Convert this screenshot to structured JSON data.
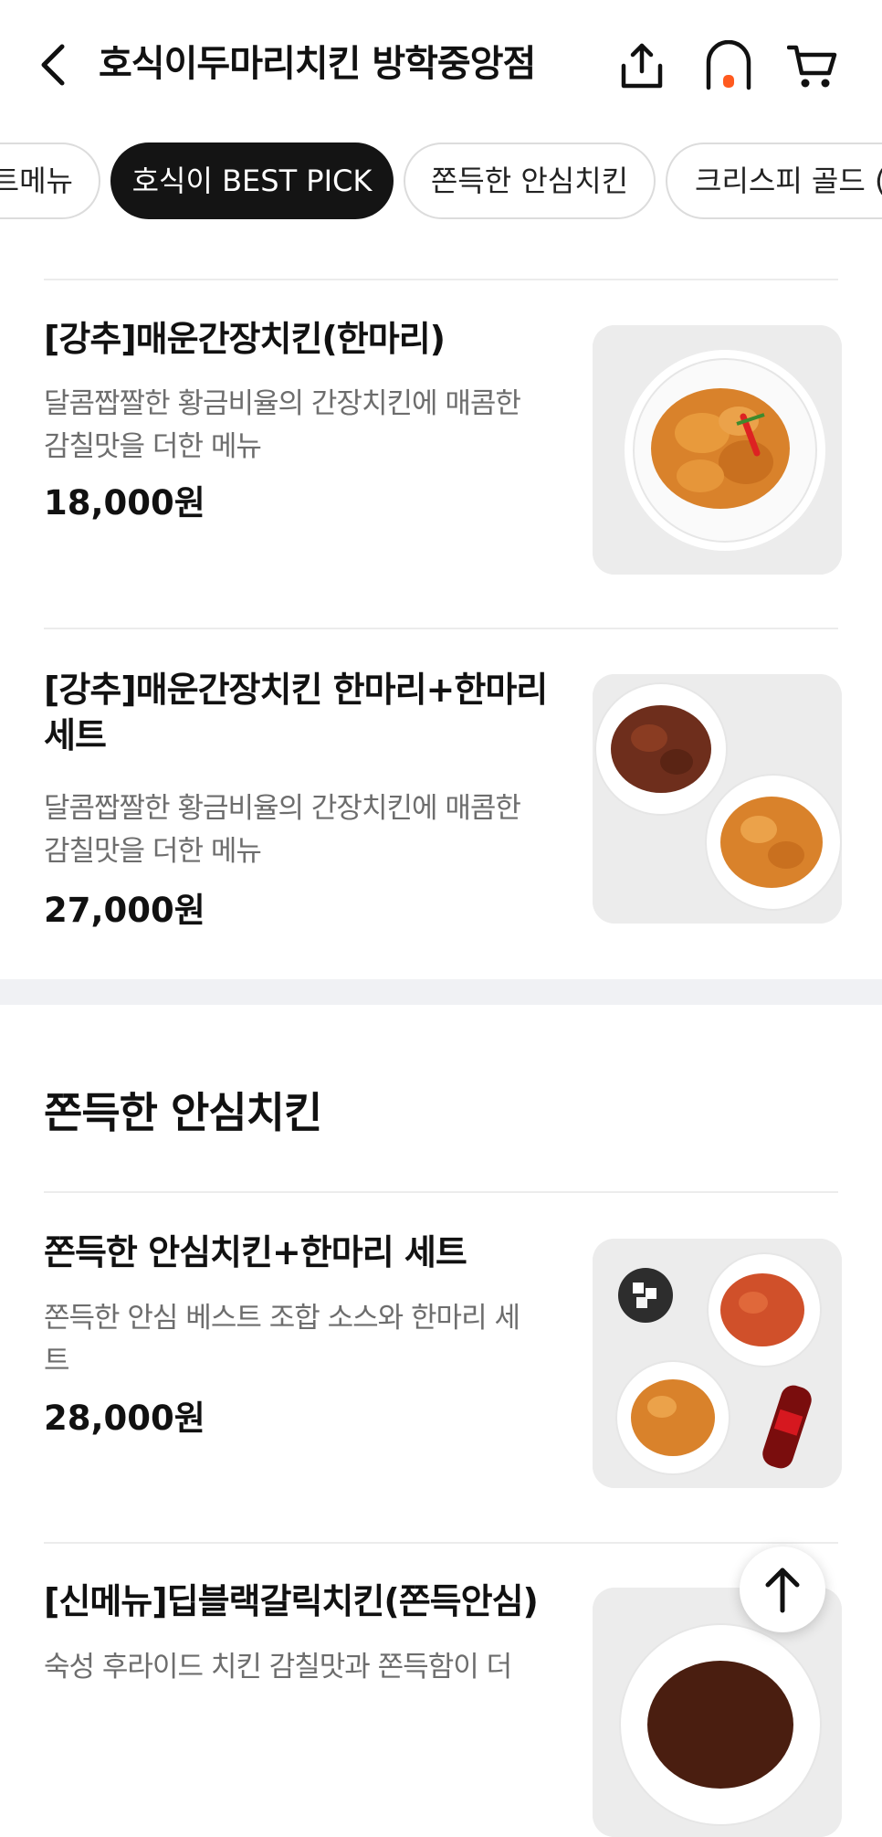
{
  "header": {
    "title": "호식이두마리치킨 방학중앙점",
    "icons": [
      "back-arrow-icon",
      "share-icon",
      "home-icon",
      "cart-icon"
    ],
    "accent_color": "#ff5a1f"
  },
  "tabs": [
    {
      "label": "트메뉴",
      "active": false
    },
    {
      "label": "호식이 BEST PICK",
      "active": true
    },
    {
      "label": "쫀득한 안심치킨",
      "active": false
    },
    {
      "label": "크리스피 골드 (",
      "active": false
    }
  ],
  "items": [
    {
      "name": "[강추]매운간장치킨(한마리)",
      "desc_line1": "달콤짭짤한 황금비율의 간장치킨에 매콤한",
      "desc_line2": "감칠맛을 더한 메뉴",
      "price": "18,000원"
    },
    {
      "name_line1": "[강추]매운간장치킨 한마리+한마리",
      "name_line2": "세트",
      "desc_line1": "달콤짭짤한 황금비율의 간장치킨에 매콤한",
      "desc_line2": "감칠맛을 더한 메뉴",
      "price": "27,000원"
    },
    {
      "name": "쫀득한 안심치킨+한마리 세트",
      "desc_line1": "쫀득한 안심 베스트 조합 소스와 한마리 세",
      "desc_line2": "트",
      "price": "28,000원"
    },
    {
      "name": "[신메뉴]딥블랙갈릭치킨(쫀득안심)",
      "desc_line1": "숙성 후라이드 치킨 감칠맛과 쫀득함이 더"
    }
  ],
  "section": {
    "title": "쫀득한 안심치킨"
  },
  "scroll_top_icon": "arrow-up-icon"
}
